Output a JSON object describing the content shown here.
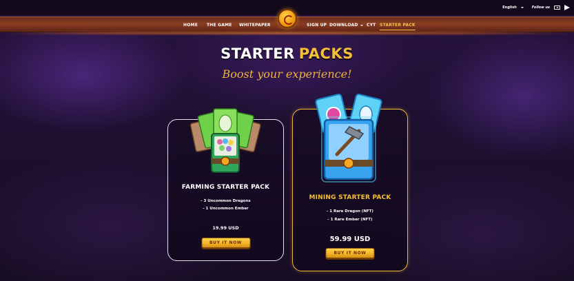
{
  "header": {
    "language": "English",
    "follow_label": "Follow us",
    "social_icons": [
      "youtube-icon",
      "telegram-icon"
    ]
  },
  "nav": {
    "items": [
      "HOME",
      "THE GAME",
      "WHITEPAPER",
      "SIGN UP",
      "DOWNLOAD",
      "CYT",
      "STARTER PACK"
    ],
    "active": "STARTER PACK",
    "logo_icon": "dragon-coin-logo-icon"
  },
  "hero": {
    "title_part1": "STARTER",
    "title_part2": "PACKS",
    "subtitle": "Boost your experience!"
  },
  "packs": [
    {
      "name": "FARMING STARTER PACK",
      "features": [
        "- 3 Uncommon Dragons",
        "- 1 Uncommon Ember"
      ],
      "price": "19.99 USD",
      "button_label": "BUY IT NOW",
      "icon": "farming-pack-icon"
    },
    {
      "name": "MINING STARTER PACK",
      "features": [
        "- 1 Rare Dragon (NFT)",
        "- 1 Rare Ember (NFT)"
      ],
      "price": "59.99 USD",
      "button_label": "BUY IT NOW",
      "icon": "mining-pack-icon",
      "highlighted": true
    }
  ],
  "colors": {
    "accent_gold": "#f5c036",
    "nav_bar": "#7a3420",
    "background": "#1c0f2e",
    "button": "#f5b528"
  }
}
